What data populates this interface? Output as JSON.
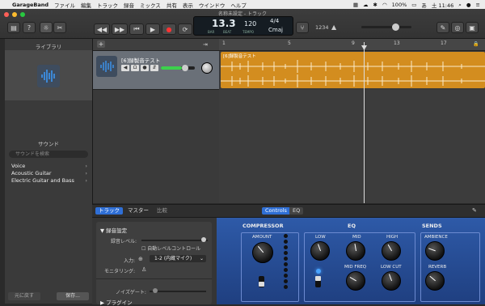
{
  "menubar": {
    "app_name": "GarageBand",
    "items": [
      "ファイル",
      "編集",
      "トラック",
      "録音",
      "ミックス",
      "共有",
      "表示",
      "ウインドウ",
      "ヘルプ"
    ],
    "battery": "100%",
    "clock": "土 11:46"
  },
  "window": {
    "title": "名称未設定 - トラック"
  },
  "lcd": {
    "position": "13.3",
    "bar_label": "BAR",
    "beat_label": "BEAT",
    "tempo": "120",
    "tempo_label": "TEMPO",
    "time_signature": "4/4",
    "key": "Cmaj",
    "count_in": "1234"
  },
  "library": {
    "title": "ライブラリ",
    "sound_label": "サウンド",
    "search_placeholder": "サウンドを検索",
    "categories": [
      "Voice",
      "Acoustic Guitar",
      "Electric Guitar and Bass"
    ],
    "revert_button": "元に戻す",
    "save_button": "保存..."
  },
  "ruler": {
    "marks": [
      "1",
      "5",
      "9",
      "13",
      "17"
    ]
  },
  "track": {
    "name": "[6]録製音テスト",
    "region_name": "[6]録製音テスト"
  },
  "smart_controls": {
    "tabs": [
      "トラック",
      "マスター",
      "比較"
    ],
    "view_tabs": [
      "Controls",
      "EQ"
    ],
    "recording_settings_header": "録音設定",
    "recording_level_label": "録音レベル:",
    "auto_level_label": "自動レベルコントロール",
    "input_label": "入力:",
    "input_value": "1-2 (内蔵マイク)",
    "monitoring_label": "モニタリング:",
    "noise_gate_label": "ノイズゲート:",
    "plugins_label": "プラグイン"
  },
  "panel": {
    "compressor_title": "COMPRESSOR",
    "eq_title": "EQ",
    "sends_title": "SENDS",
    "amount_label": "AMOUNT",
    "low_label": "LOW",
    "mid_label": "MID",
    "high_label": "HIGH",
    "mid_freq_label": "MID FREQ",
    "low_cut_label": "LOW CUT",
    "ambience_label": "AMBIENCE",
    "reverb_label": "REVERB"
  }
}
